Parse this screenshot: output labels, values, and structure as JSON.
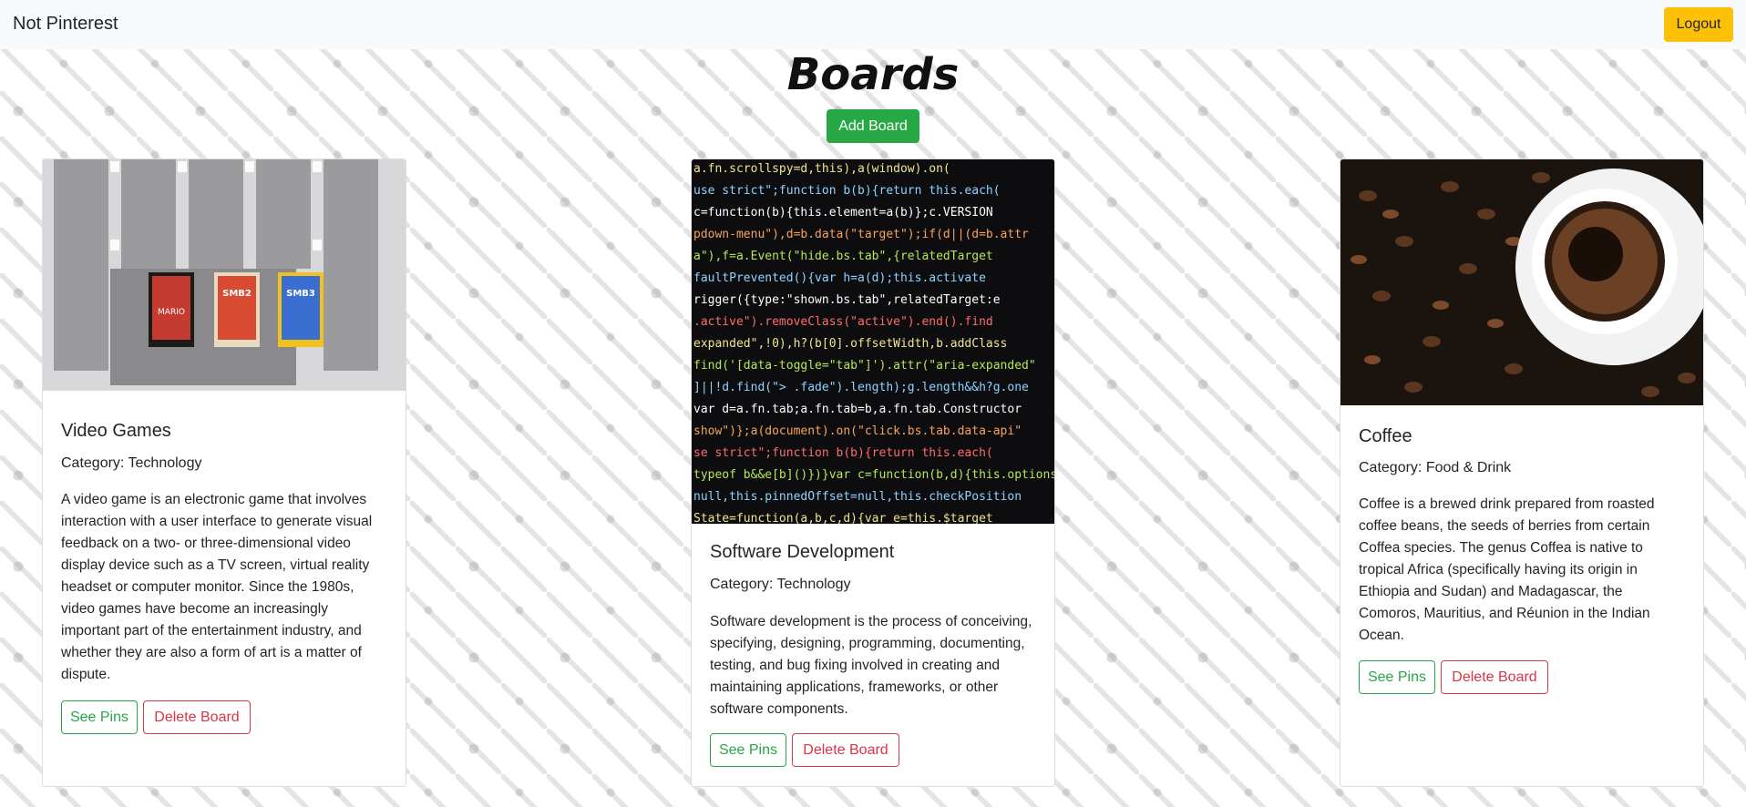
{
  "navbar": {
    "brand": "Not Pinterest",
    "logout_label": "Logout"
  },
  "page": {
    "title": "Boards",
    "add_board_label": "Add Board"
  },
  "boards": [
    {
      "title": "Video Games",
      "category": "Category: Technology",
      "description": "A video game is an electronic game that involves interaction with a user interface to generate visual feedback on a two- or three-dimensional video display device such as a TV screen, virtual reality headset or computer monitor. Since the 1980s, video games have become an increasingly important part of the entertainment industry, and whether they are also a form of art is a matter of dispute.",
      "see_pins_label": "See Pins",
      "delete_label": "Delete Board"
    },
    {
      "title": "Software Development",
      "category": "Category: Technology",
      "description": "Software development is the process of conceiving, specifying, designing, programming, documenting, testing, and bug fixing involved in creating and maintaining applications, frameworks, or other software components.",
      "see_pins_label": "See Pins",
      "delete_label": "Delete Board"
    },
    {
      "title": "Coffee",
      "category": "Category: Food & Drink",
      "description": "Coffee is a brewed drink prepared from roasted coffee beans, the seeds of berries from certain Coffea species. The genus Coffea is native to tropical Africa (specifically having its origin in Ethiopia and Sudan) and Madagascar, the Comoros, Mauritius, and Réunion in the Indian Ocean.",
      "see_pins_label": "See Pins",
      "delete_label": "Delete Board"
    }
  ]
}
